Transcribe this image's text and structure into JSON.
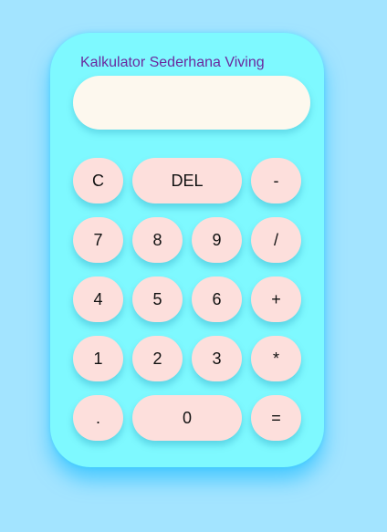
{
  "title": "Kalkulator Sederhana Viving",
  "display": {
    "value": ""
  },
  "keys": {
    "clear": "C",
    "delete": "DEL",
    "minus": "-",
    "seven": "7",
    "eight": "8",
    "nine": "9",
    "divide": "/",
    "four": "4",
    "five": "5",
    "six": "6",
    "plus": "+",
    "one": "1",
    "two": "2",
    "three": "3",
    "multiply": "*",
    "dot": ".",
    "zero": "0",
    "equals": "="
  },
  "colors": {
    "background": "#a3e4ff",
    "calculator_body": "#7ef9ff",
    "display": "#fdf8ee",
    "key": "#fddfdc",
    "title_text": "#6b2a9e"
  }
}
